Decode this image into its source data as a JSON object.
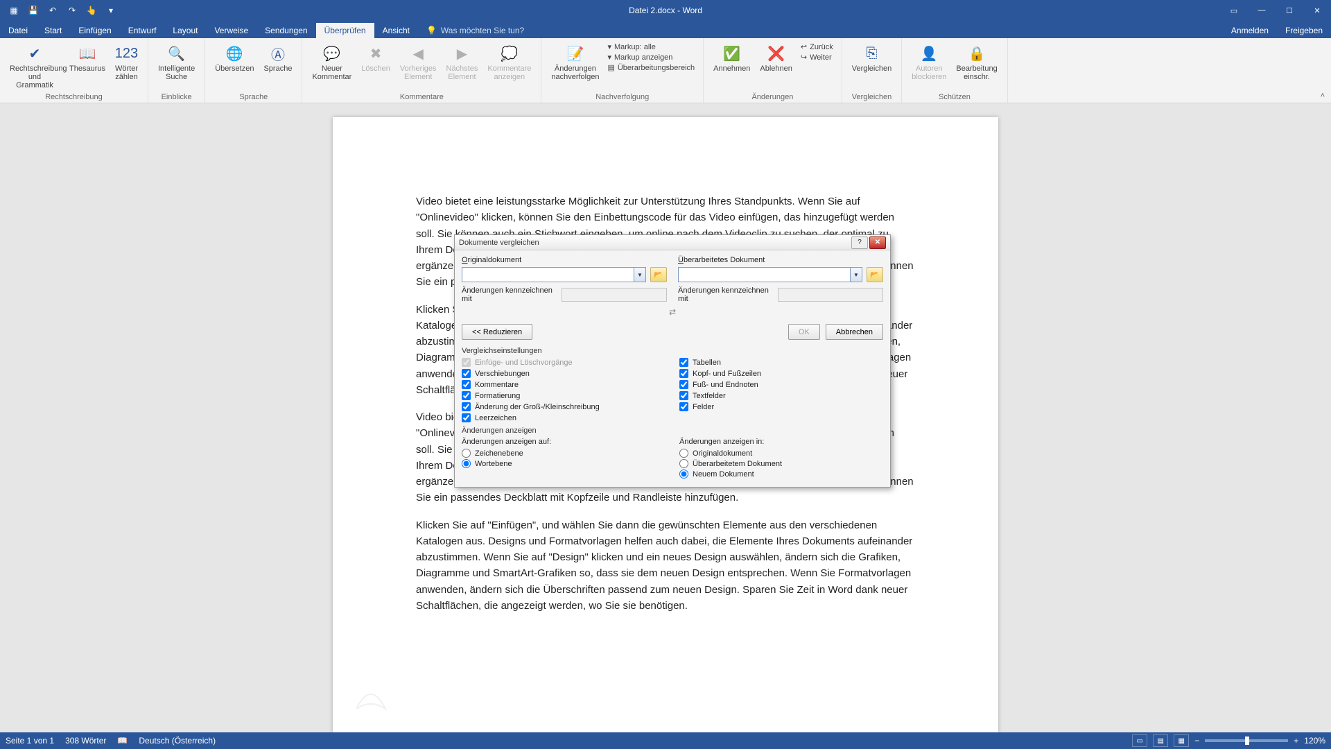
{
  "titlebar": {
    "title": "Datei 2.docx - Word",
    "qat": {
      "save": "💾",
      "undo": "↶",
      "redo": "↷",
      "touch": "👆"
    }
  },
  "tabs": {
    "file": "Datei",
    "items": [
      "Start",
      "Einfügen",
      "Entwurf",
      "Layout",
      "Verweise",
      "Sendungen",
      "Überprüfen",
      "Ansicht"
    ],
    "active_index": 6,
    "tell_me": "Was möchten Sie tun?",
    "signin": "Anmelden",
    "share": "Freigeben"
  },
  "ribbon": {
    "g1": {
      "label": "Rechtschreibung",
      "btn1": "Rechtschreibung\nund Grammatik",
      "btn2": "Thesaurus",
      "btn3": "Wörter\nzählen"
    },
    "g2": {
      "label": "Einblicke",
      "btn1": "Intelligente\nSuche"
    },
    "g3": {
      "label": "Sprache",
      "btn1": "Übersetzen",
      "btn2": "Sprache"
    },
    "g4": {
      "label": "Kommentare",
      "btn1": "Neuer\nKommentar",
      "btn2": "Löschen",
      "btn3": "Vorheriges\nElement",
      "btn4": "Nächstes\nElement",
      "btn5": "Kommentare\nanzeigen"
    },
    "g5": {
      "label": "Nachverfolgung",
      "btn1": "Änderungen\nnachverfolgen",
      "row1": "Markup: alle",
      "row2": "Markup anzeigen",
      "row3": "Überarbeitungsbereich"
    },
    "g6": {
      "label": "Änderungen",
      "btn1": "Annehmen",
      "btn2": "Ablehnen",
      "row1": "Zurück",
      "row2": "Weiter"
    },
    "g7": {
      "label": "Vergleichen",
      "btn1": "Vergleichen"
    },
    "g8": {
      "label": "Schützen",
      "btn1": "Autoren\nblockieren",
      "btn2": "Bearbeitung\neinschr."
    }
  },
  "document": {
    "para1": "Video bietet eine leistungsstarke Möglichkeit zur Unterstützung Ihres Standpunkts. Wenn Sie auf \"Onlinevideo\" klicken, können Sie den Einbettungscode für das Video einfügen, das hinzugefügt werden soll. Sie können auch ein Stichwort eingeben, um online nach dem Videoclip zu suchen, der optimal zu Ihrem Dokument passt. Damit Ihr Dokument ein professionelles Aussehen erhält, stellt Word einander ergänzende Designs für Kopfzeile, Fußzeile, Deckblatt und Textfelder zur Verfügung. Beispielsweise können Sie ein passendes Deckblatt mit Kopfzeile und Randleiste hinzufügen.",
    "para2": "Klicken Sie auf \"Einfügen\", und wählen Sie dann die gewünschten Elemente aus den verschiedenen Katalogen aus. Designs und Formatvorlagen helfen auch dabei, die Elemente Ihres Dokuments aufeinander abzustimmen. Wenn Sie auf \"Design\" klicken und ein neues Design auswählen, ändern sich die Grafiken, Diagramme und SmartArt-Grafiken so, dass sie dem neuen Design entsprechen. Wenn Sie Formatvorlagen anwenden, ändern sich die Überschriften passend zum neuen Design. Sparen Sie Zeit in Word dank neuer Schaltflächen, die angezeigt werden, wo Sie sie benötigen.",
    "para3": "Video bietet eine leistungsstarke Möglichkeit zur Unterstützung Ihres Standpunkts. Wenn Sie auf \"Onlinevideo\" klicken, können Sie den Einbettungscode für das Video einfügen, das hinzugefügt werden soll. Sie können auch ein Stichwort eingeben, um online nach dem Videoclip zu suchen, der optimal zu Ihrem Dokument passt. Damit Ihr Dokument ein professionelles Aussehen erhält, stellt Word einander ergänzende Designs für Kopfzeile, Fußzeile, Deckblatt und Textfelder zur Verfügung. Beispielsweise können Sie ein passendes Deckblatt mit Kopfzeile und Randleiste hinzufügen.",
    "para4": "Klicken Sie auf \"Einfügen\", und wählen Sie dann die gewünschten Elemente aus den verschiedenen Katalogen aus. Designs und Formatvorlagen helfen auch dabei, die Elemente Ihres Dokuments aufeinander abzustimmen. Wenn Sie auf \"Design\" klicken und ein neues Design auswählen, ändern sich die Grafiken, Diagramme und SmartArt-Grafiken so, dass sie dem neuen Design entsprechen. Wenn Sie Formatvorlagen anwenden, ändern sich die Überschriften passend zum neuen Design. Sparen Sie Zeit in Word dank neuer Schaltflächen, die angezeigt werden, wo Sie sie benötigen."
  },
  "dialog": {
    "title": "Dokumente vergleichen",
    "orig_label": "Originaldokument",
    "rev_label": "Überarbeitetes Dokument",
    "mark_label": "Änderungen kennzeichnen mit",
    "swap": "⇄",
    "reduce": "<< Reduzieren",
    "ok": "OK",
    "cancel": "Abbrechen",
    "compare_head": "Vergleichseinstellungen",
    "chk": {
      "insdel": "Einfüge- und Löschvorgänge",
      "moves": "Verschiebungen",
      "comments": "Kommentare",
      "format": "Formatierung",
      "case": "Änderung der Groß-/Kleinschreibung",
      "ws": "Leerzeichen",
      "tables": "Tabellen",
      "headers": "Kopf- und Fußzeilen",
      "footnotes": "Fuß- und Endnoten",
      "textboxes": "Textfelder",
      "fields": "Felder"
    },
    "show_head": "Änderungen anzeigen",
    "show_at_label": "Änderungen anzeigen auf:",
    "show_at": {
      "char": "Zeichenebene",
      "word": "Wortebene"
    },
    "show_in_label": "Änderungen anzeigen in:",
    "show_in": {
      "orig": "Originaldokument",
      "rev": "Überarbeitetem Dokument",
      "new": "Neuem Dokument"
    }
  },
  "status": {
    "page": "Seite 1 von 1",
    "words": "308 Wörter",
    "lang": "Deutsch (Österreich)",
    "zoom": "120%"
  }
}
